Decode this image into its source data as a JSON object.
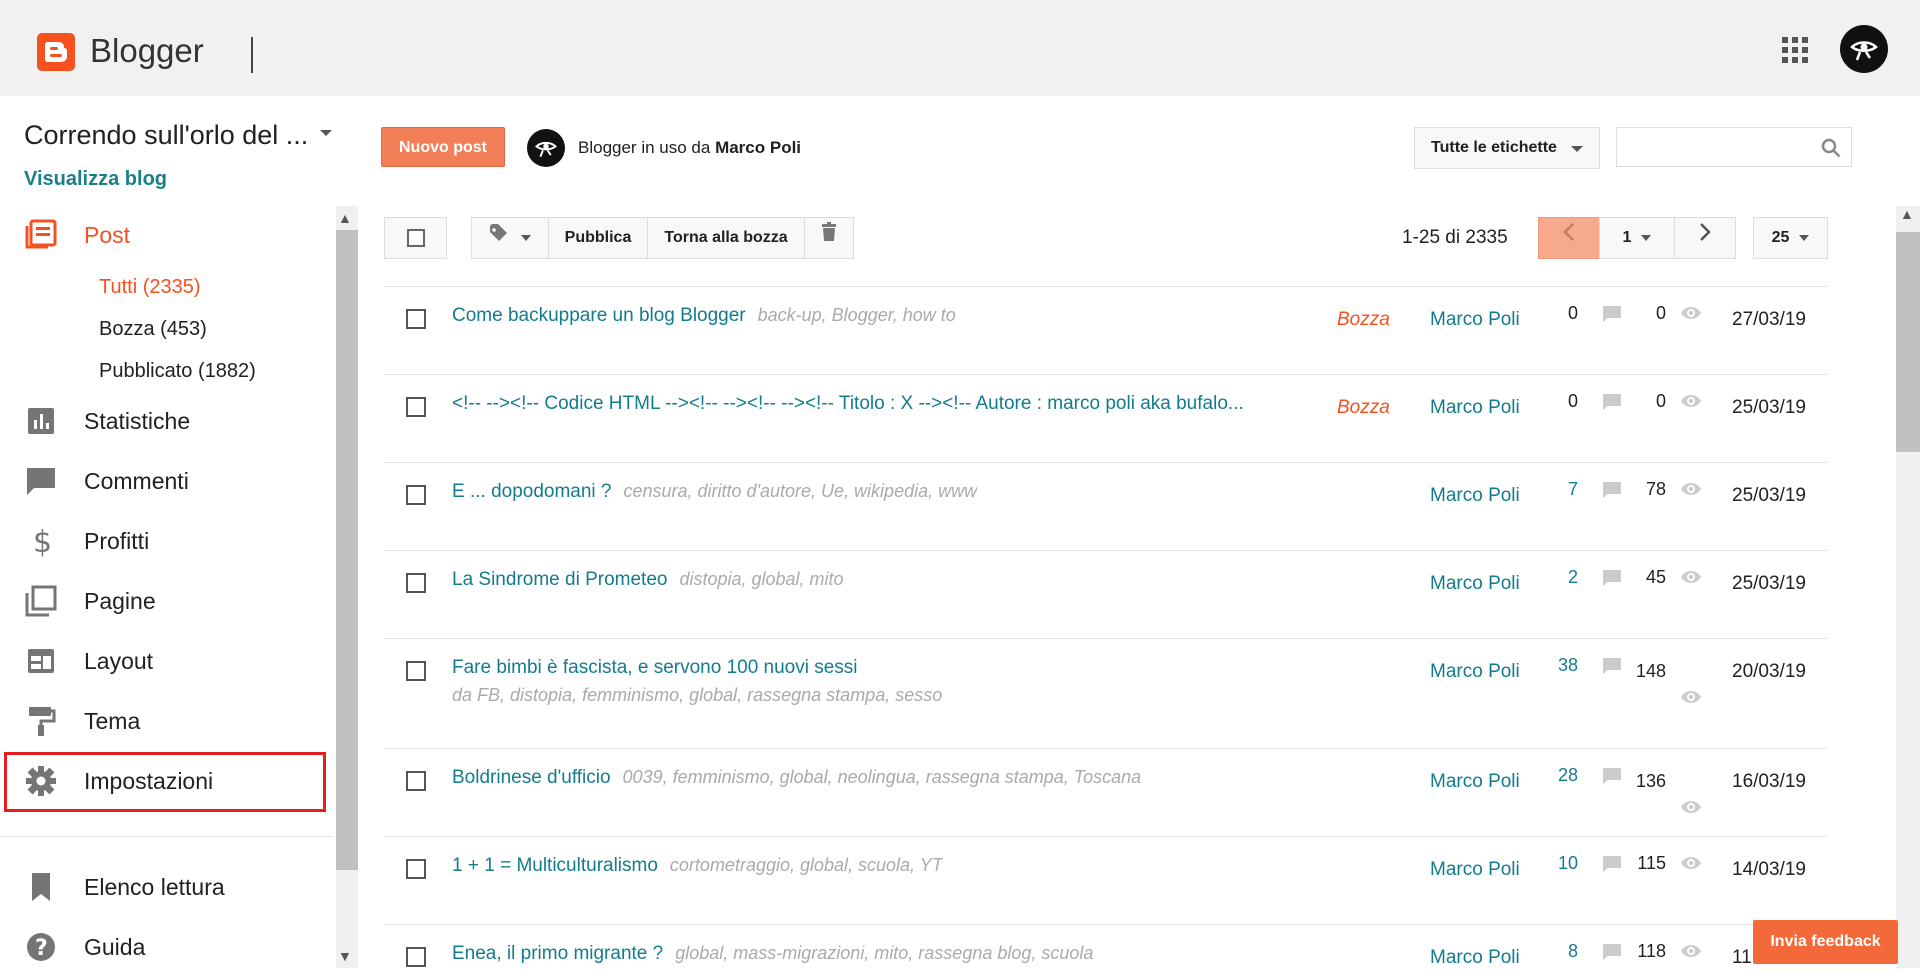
{
  "app": {
    "name": "Blogger"
  },
  "sidebar": {
    "blog_title": "Correndo sull'orlo del ...",
    "view_blog": "Visualizza blog",
    "items": [
      {
        "label": "Post",
        "icon": "posts-icon"
      },
      {
        "label": "Statistiche",
        "icon": "stats-icon"
      },
      {
        "label": "Commenti",
        "icon": "comments-icon"
      },
      {
        "label": "Profitti",
        "icon": "dollar-icon"
      },
      {
        "label": "Pagine",
        "icon": "pages-icon"
      },
      {
        "label": "Layout",
        "icon": "layout-icon"
      },
      {
        "label": "Tema",
        "icon": "paint-roller-icon"
      },
      {
        "label": "Impostazioni",
        "icon": "gear-icon"
      },
      {
        "label": "Elenco lettura",
        "icon": "bookmark-icon"
      },
      {
        "label": "Guida",
        "icon": "help-icon"
      }
    ],
    "subitems": [
      "Tutti (2335)",
      "Bozza (453)",
      "Pubblicato (1882)"
    ]
  },
  "header": {
    "new_post": "Nuovo post",
    "user_prefix": "Blogger in uso da",
    "user_name": "Marco Poli",
    "labels_filter": "Tutte le etichette",
    "search_placeholder": ""
  },
  "toolbar": {
    "publish": "Pubblica",
    "revert": "Torna alla bozza",
    "range": "1-25 di 2335",
    "page": "1",
    "per_page": "25"
  },
  "posts": [
    {
      "title": "Come backuppare un blog Blogger",
      "labels": "back-up, Blogger, how to",
      "status": "Bozza",
      "author": "Marco Poli",
      "comments": "0",
      "views": "0",
      "date": "27/03/19"
    },
    {
      "title": "<!-- --><!-- Codice HTML --><!-- --><!-- --><!-- Titolo : X --><!-- Autore : marco poli aka bufalo...",
      "labels": "",
      "status": "Bozza",
      "author": "Marco Poli",
      "comments": "0",
      "views": "0",
      "date": "25/03/19"
    },
    {
      "title": "E ... dopodomani ?",
      "labels": "censura, diritto d'autore, Ue, wikipedia, www",
      "status": "",
      "author": "Marco Poli",
      "comments": "7",
      "views": "78",
      "date": "25/03/19"
    },
    {
      "title": "La Sindrome di Prometeo",
      "labels": "distopia, global, mito",
      "status": "",
      "author": "Marco Poli",
      "comments": "2",
      "views": "45",
      "date": "25/03/19"
    },
    {
      "title": "Fare bimbi è fascista, e servono 100 nuovi sessi",
      "labels": "da FB, distopia, femminismo, global, rassegna stampa, sesso",
      "status": "",
      "author": "Marco Poli",
      "comments": "38",
      "views": "148",
      "date": "20/03/19"
    },
    {
      "title": "Boldrinese d'ufficio",
      "labels": "0039, femminismo, global, neolingua, rassegna stampa, Toscana",
      "status": "",
      "author": "Marco Poli",
      "comments": "28",
      "views": "136",
      "date": "16/03/19"
    },
    {
      "title": "1 + 1 = Multiculturalismo",
      "labels": "cortometraggio, global, scuola, YT",
      "status": "",
      "author": "Marco Poli",
      "comments": "10",
      "views": "115",
      "date": "14/03/19"
    },
    {
      "title": "Enea, il primo migrante ?",
      "labels": "global, mass-migrazioni, mito, rassegna blog, scuola",
      "status": "",
      "author": "Marco Poli",
      "comments": "8",
      "views": "118",
      "date": "11"
    }
  ],
  "feedback": "Invia feedback",
  "colors": {
    "accent": "#f4511e",
    "link": "#137c8c",
    "label": "#aaaaaa"
  }
}
